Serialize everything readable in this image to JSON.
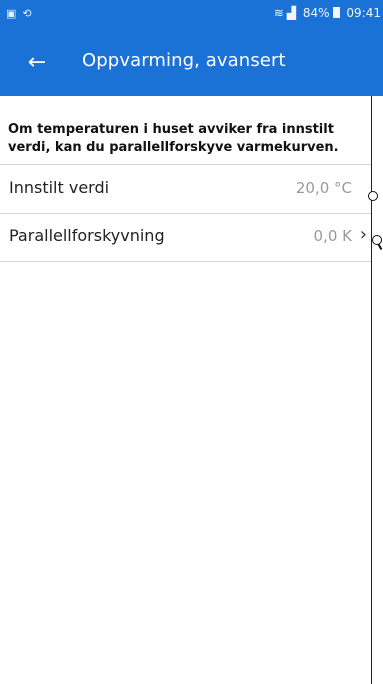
{
  "status_bar": {
    "left_icons": [
      "notification-icon",
      "sync-icon"
    ],
    "signal_text": "",
    "battery": "84%",
    "time": "09:41"
  },
  "app_bar": {
    "back_symbol": "←",
    "title": "Oppvarming, avansert"
  },
  "intro_text": "Om temperaturen i huset avviker fra innstilt verdi, kan du parallellforskyve varmekurven.",
  "settings": [
    {
      "label": "Innstilt verdi",
      "value": "20,0 °C"
    },
    {
      "label": "Parallellforskyvning",
      "value": "0,0 K"
    }
  ],
  "colors": {
    "primary": "#1a72d6",
    "value_text": "#9a9a9a",
    "divider": "#d6d6d6"
  }
}
